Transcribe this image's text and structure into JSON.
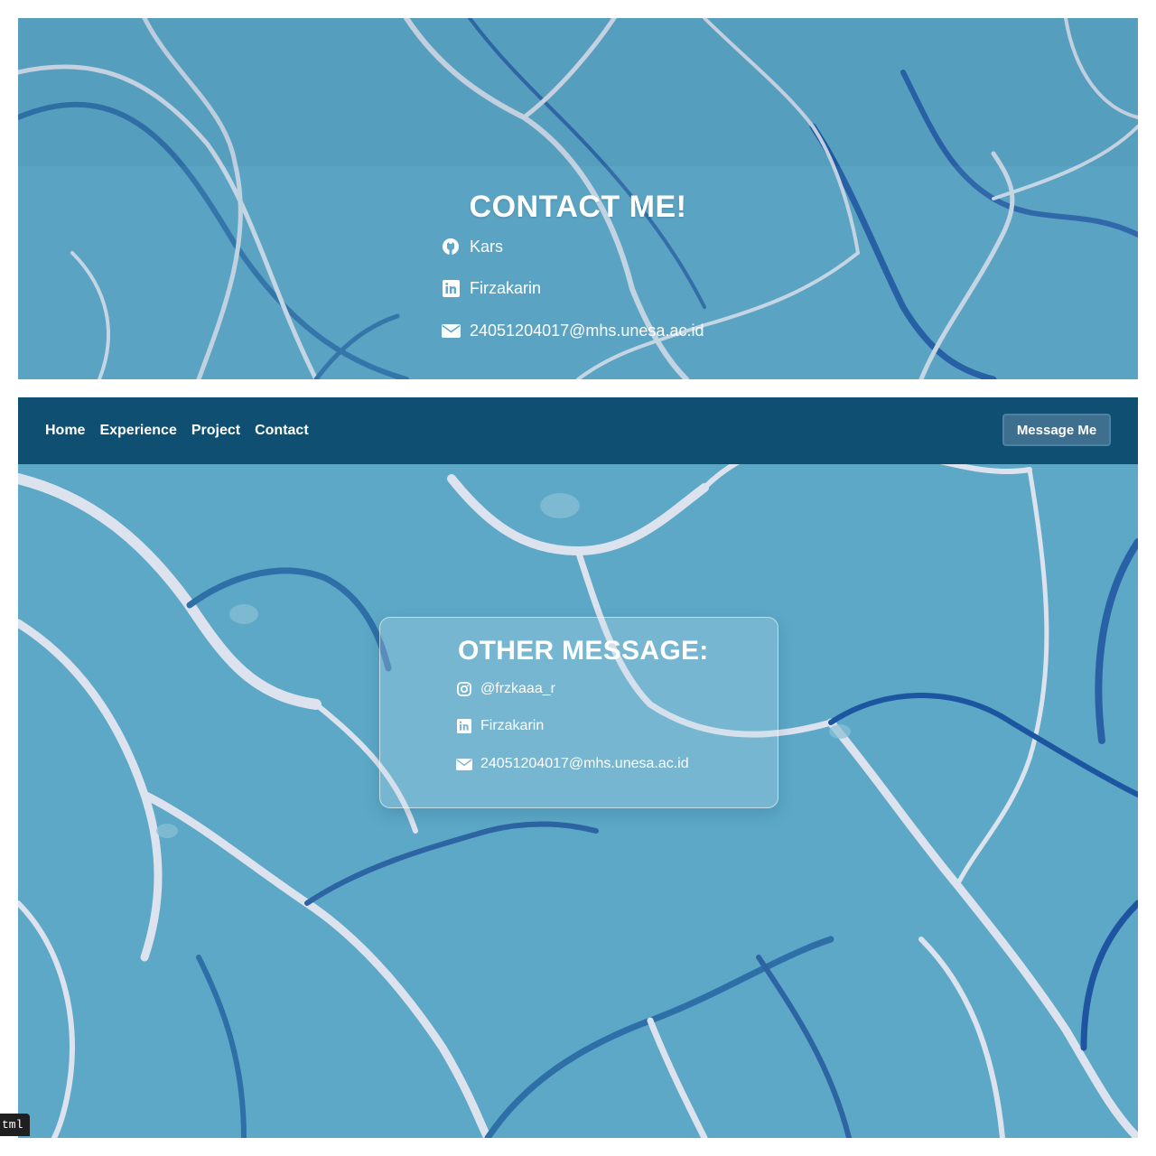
{
  "contact_section": {
    "title": "CONTACT ME!",
    "items": [
      {
        "icon": "github-icon",
        "label": "Kars"
      },
      {
        "icon": "linkedin-icon",
        "label": "Firzakarin"
      },
      {
        "icon": "envelope-icon",
        "label": "24051204017@mhs.unesa.ac.id"
      }
    ]
  },
  "navbar": {
    "links": [
      "Home",
      "Experience",
      "Project",
      "Contact"
    ],
    "button_label": "Message Me"
  },
  "other_message": {
    "title": "OTHER MESSAGE:",
    "items": [
      {
        "icon": "instagram-icon",
        "label": "@frzkaaa_r"
      },
      {
        "icon": "linkedin-icon",
        "label": "Firzakarin"
      },
      {
        "icon": "envelope-icon",
        "label": "24051204017@mhs.unesa.ac.id"
      }
    ]
  },
  "devtools_tag": "tml",
  "colors": {
    "navbar": "#0f4f72",
    "background": "#5aa6c4",
    "accent_line_dark": "#1f5fa6",
    "accent_line_light": "#d8dde8"
  }
}
